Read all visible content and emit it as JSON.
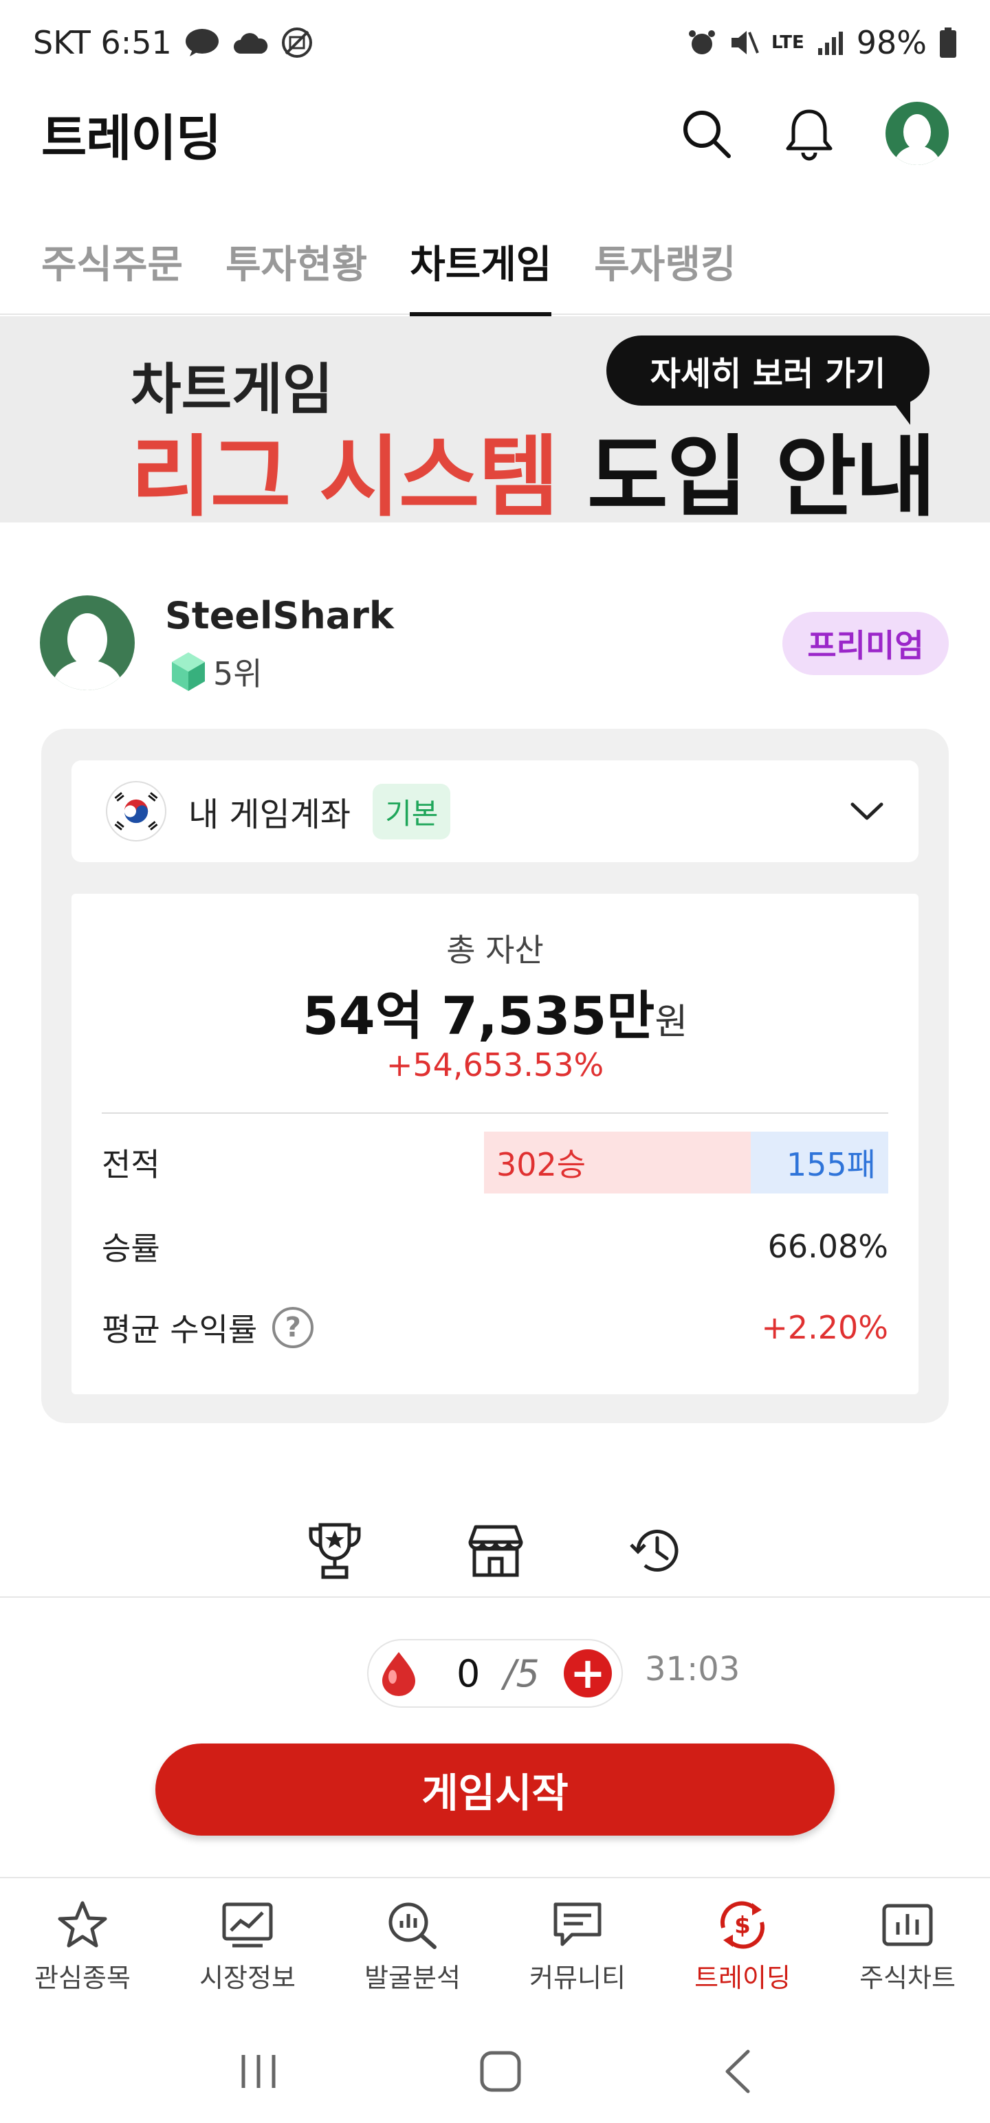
{
  "status_bar": {
    "carrier_time": "SKT 6:51",
    "battery": "98%",
    "network": "LTE"
  },
  "header": {
    "title": "트레이딩"
  },
  "tabs": [
    {
      "label": "주식주문",
      "active": false
    },
    {
      "label": "투자현황",
      "active": false
    },
    {
      "label": "차트게임",
      "active": true
    },
    {
      "label": "투자랭킹",
      "active": false
    }
  ],
  "banner": {
    "line1": "차트게임",
    "line2_red": "리그 시스템",
    "line2_dark": " 도입 안내",
    "cta": "자세히 보러 가기"
  },
  "profile": {
    "username": "SteelShark",
    "rank": "5위",
    "badge": "프리미엄"
  },
  "account": {
    "label": "내 게임계좌",
    "type_badge": "기본"
  },
  "summary": {
    "total_label": "총 자산",
    "total_value": "54억 7,535만",
    "total_unit": "원",
    "total_pct": "+54,653.53%",
    "record_label": "전적",
    "wins": "302승",
    "losses": "155패",
    "win_rate_label": "승률",
    "win_rate": "66.08%",
    "avg_return_label": "평균 수익률",
    "avg_return": "+2.20%",
    "help_glyph": "?"
  },
  "energy": {
    "count": "0",
    "max": "/5",
    "timer": "31:03",
    "plus_glyph": "+"
  },
  "start_button": "게임시작",
  "bottom_nav": [
    {
      "label": "관심종목",
      "icon": "star-icon",
      "active": false
    },
    {
      "label": "시장정보",
      "icon": "market-chart-icon",
      "active": false
    },
    {
      "label": "발굴분석",
      "icon": "search-analysis-icon",
      "active": false
    },
    {
      "label": "커뮤니티",
      "icon": "chat-icon",
      "active": false
    },
    {
      "label": "트레이딩",
      "icon": "trading-icon",
      "active": true
    },
    {
      "label": "주식차트",
      "icon": "bar-chart-icon",
      "active": false
    }
  ],
  "colors": {
    "accent": "#d11e16",
    "banner_red": "#e2463c",
    "premium_bg": "#f1ddfa",
    "premium_text": "#9b27c9",
    "win": "#e03131",
    "loss": "#2f74d9"
  }
}
